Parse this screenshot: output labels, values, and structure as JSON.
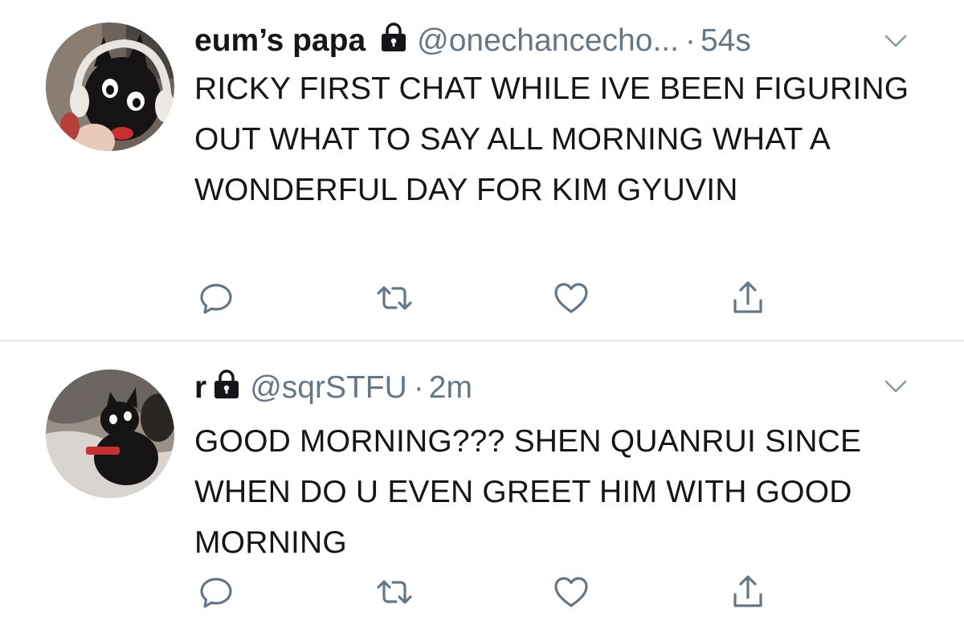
{
  "colors": {
    "text": "#14171a",
    "secondary": "#657786",
    "icon": "#657786",
    "divider": "#e1e8ed"
  },
  "tweets": [
    {
      "name": "eum’s papa",
      "handle": "@onechancecho...",
      "dot": "·",
      "time": "54s",
      "text": "RICKY FIRST CHAT WHILE IVE BEEN FIGURING OUT WHAT TO SAY ALL MORNING WHAT A WONDERFUL DAY FOR KIM GYUVIN",
      "protected": true,
      "avatar": "black-cat-plush-with-headphones"
    },
    {
      "name": "r",
      "handle": "@sqrSTFU",
      "dot": "·",
      "time": "2m",
      "text": "GOOD MORNING??? SHEN QUANRUI SINCE WHEN DO U EVEN GREET HIM WITH GOOD MORNING",
      "protected": true,
      "avatar": "black-cat-plush-lying-down"
    }
  ],
  "icons": [
    "lock-icon",
    "chevron-down-icon",
    "reply-icon",
    "retweet-icon",
    "like-icon",
    "share-icon"
  ]
}
